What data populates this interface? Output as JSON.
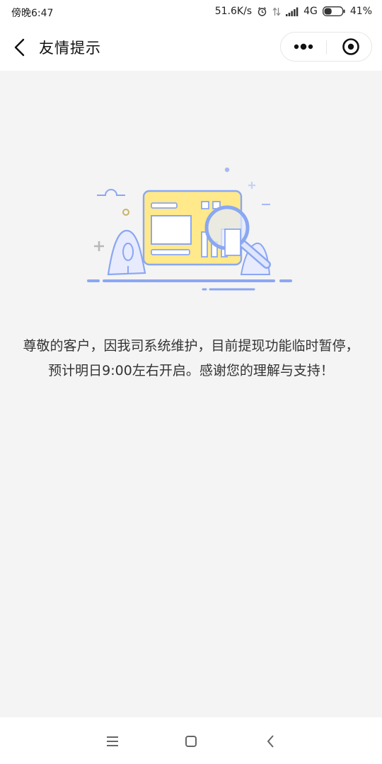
{
  "status_bar": {
    "time": "傍晚6:47",
    "network_speed": "51.6K/s",
    "network_type": "4G",
    "battery": "41%",
    "battery_level": 0.41,
    "icons": [
      "alarm-icon",
      "data-transfer-icon",
      "signal-icon",
      "battery-icon"
    ]
  },
  "nav": {
    "title": "友情提示",
    "icons": [
      "back-icon",
      "more-dots-icon",
      "close-circle-icon"
    ]
  },
  "main": {
    "illustration_icon": "maintenance-magnifier-illustration",
    "message": "尊敬的客户，因我司系统维护，目前提现功能临时暂停，预计明日9:00左右开启。感谢您的理解与支持！"
  },
  "system_nav": {
    "icons": [
      "menu-icon",
      "home-icon",
      "back-icon"
    ]
  },
  "colors": {
    "accent_blue": "#8aa7f2",
    "card_yellow": "#ffe98a",
    "background": "#f4f4f4"
  }
}
